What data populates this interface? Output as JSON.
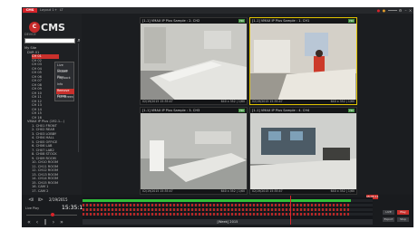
{
  "app": {
    "badge": "CMS",
    "tabs": [
      "Layout 1",
      "+",
      "LT"
    ],
    "logo_mark": "C",
    "logo_text": "CMS",
    "section_label": "DEVICE"
  },
  "search": {
    "placeholder": "",
    "icon": "search-icon"
  },
  "tree": {
    "root": "My Site",
    "rows": [
      "My Site",
      "DVR 01",
      "CH 01",
      "CH 02",
      "CH 03",
      "CH 04",
      "CH 05",
      "CH 06",
      "CH 07",
      "CH 08",
      "CH 09",
      "CH 10",
      "CH 11",
      "CH 12",
      "CH 13",
      "CH 14",
      "CH 15",
      "CH 16",
      "VMAX IP Plus (192.1...)",
      "1. CH01 FRONT",
      "2. CH02 REAR",
      "3. CH03 LOBBY",
      "4. CH04 HALL",
      "5. CH05 OFFICE",
      "6. CH06 LAB",
      "7. CH07 LAB2",
      "8. CH08 STOCK",
      "9. CH09 ROOM",
      "10. CH10 ROOM",
      "11. CH11 ROOM",
      "12. CH12 ROOM",
      "13. CH13 ROOM",
      "14. CH14 ROOM",
      "15. CH15 ROOM",
      "16. CAM 1",
      "17. CAM 2"
    ],
    "selected_index": 2
  },
  "context_menu": {
    "items": [
      "Live Stream",
      "Instant Play",
      "Playback",
      "Info",
      "Remove Group",
      "Full Screen"
    ],
    "highlight_index": 4
  },
  "cameras": [
    {
      "title": "[1-1] VMAX IP Plus Sample : 2. CH2",
      "badge": "HD",
      "timestamp": "02/19/2015 15:35:47",
      "resolution": "640 x 352 | 1/60",
      "selected": false
    },
    {
      "title": "[1-1] VMAX IP Plus Sample : 1. CH1",
      "badge": "HD",
      "timestamp": "02/19/2015 15:35:47",
      "resolution": "640 x 352 | 1/60",
      "selected": true
    },
    {
      "title": "[1-1] VMAX IP Plus Sample : 3. CH3",
      "badge": "HD",
      "timestamp": "02/19/2015 15:35:47",
      "resolution": "640 x 352 | 1/60",
      "selected": false
    },
    {
      "title": "[1-1] VMAX IP Plus Sample : 4. CH4",
      "badge": "HD",
      "timestamp": "02/19/2015 15:35:47",
      "resolution": "640 x 352 | 1/60",
      "selected": false
    }
  ],
  "playback": {
    "date": "2/19/2015",
    "time": "15:35:11",
    "status_label": "Live Play",
    "timeline_label": "[Week] 2015",
    "buttons_right": [
      "LIVE",
      "Play",
      "Export",
      "Stop"
    ],
    "cursor_label": "15:35:11"
  },
  "colors": {
    "accent": "#d8232a",
    "selected_border": "#e0c200",
    "timeline_green": "#2fbf3a",
    "timeline_red": "#b82727"
  }
}
